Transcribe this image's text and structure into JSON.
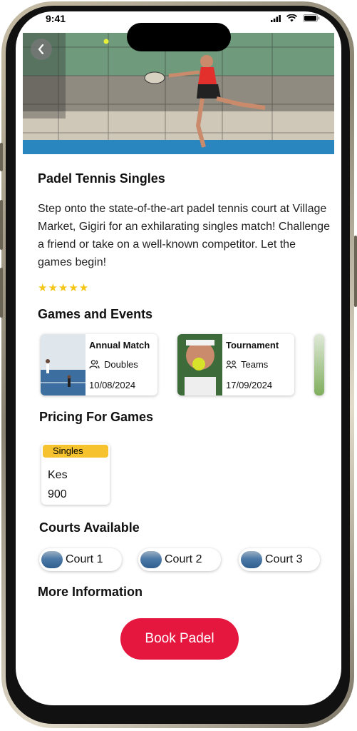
{
  "status_bar": {
    "time": "9:41"
  },
  "hero": {
    "image": "padel-player-photo"
  },
  "title": "Padel Tennis Singles",
  "description": "Step onto the state-of-the-art padel tennis court at Village Market, Gigiri for an exhilarating singles match! Challenge a friend or take on a well-known competitor. Let the games begin!",
  "rating": {
    "stars": 5,
    "symbol": "★★★★★"
  },
  "games": {
    "heading": "Games and Events",
    "items": [
      {
        "name": "Annual Match",
        "type": "Doubles",
        "date": "10/08/2024"
      },
      {
        "name": "Tournament",
        "type": "Teams",
        "date": "17/09/2024"
      }
    ]
  },
  "pricing": {
    "heading": "Pricing For Games",
    "items": [
      {
        "label": "Singles",
        "currency": "Kes",
        "amount": "900"
      }
    ]
  },
  "courts": {
    "heading": "Courts Available",
    "items": [
      {
        "label": "Court 1"
      },
      {
        "label": "Court 2"
      },
      {
        "label": "Court 3"
      }
    ]
  },
  "more_info": {
    "heading": "More Information"
  },
  "cta": {
    "label": "Book Padel"
  },
  "colors": {
    "accent": "#e5173f",
    "star": "#f5c518",
    "badge": "#f6c32e"
  }
}
